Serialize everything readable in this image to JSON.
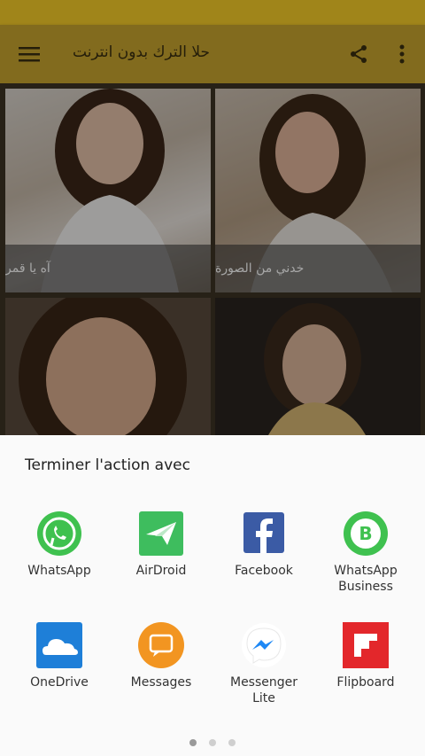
{
  "app_bar": {
    "title": "حلا الترك بدون انترنت",
    "menu_icon": "hamburger-menu-icon",
    "share_icon": "share-icon",
    "overflow_icon": "more-vert-icon",
    "accent": "#c8a52e"
  },
  "songs": [
    {
      "caption": "آه يا قمر"
    },
    {
      "caption": "خدني من الصورة"
    },
    {
      "caption": ""
    },
    {
      "caption": ""
    }
  ],
  "share_sheet": {
    "title": "Terminer l'action avec",
    "apps": [
      {
        "label": "WhatsApp",
        "icon": "whatsapp-icon"
      },
      {
        "label": "AirDroid",
        "icon": "airdroid-icon"
      },
      {
        "label": "Facebook",
        "icon": "facebook-icon"
      },
      {
        "label": "WhatsApp\nBusiness",
        "icon": "whatsapp-business-icon"
      },
      {
        "label": "OneDrive",
        "icon": "onedrive-icon"
      },
      {
        "label": "Messages",
        "icon": "messages-icon"
      },
      {
        "label": "Messenger\nLite",
        "icon": "messenger-lite-icon"
      },
      {
        "label": "Flipboard",
        "icon": "flipboard-icon"
      }
    ],
    "page_dots": {
      "count": 3,
      "active": 1
    }
  }
}
